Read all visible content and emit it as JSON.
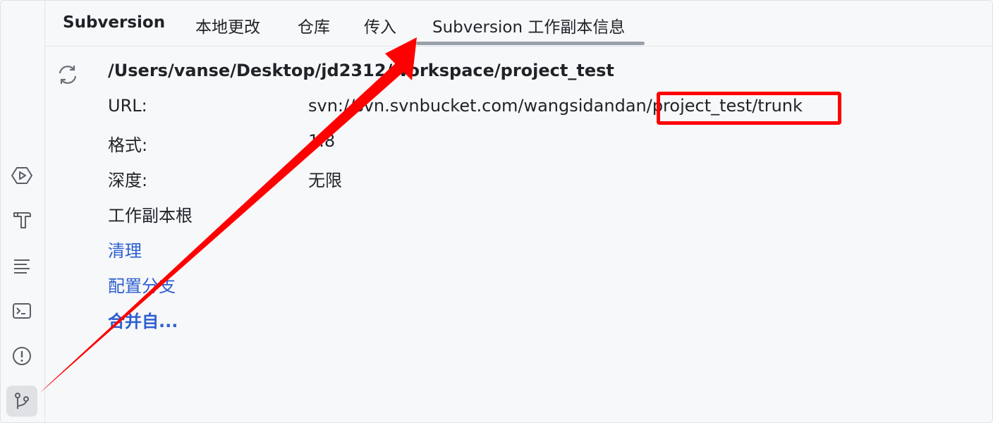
{
  "tabs": [
    {
      "label": "Subversion",
      "active": false
    },
    {
      "label": "本地更改",
      "active": false
    },
    {
      "label": "仓库",
      "active": false
    },
    {
      "label": "传入",
      "active": false
    },
    {
      "label": "Subversion 工作副本信息",
      "active": true
    }
  ],
  "info": {
    "path": "/Users/vanse/Desktop/jd2312/workspace/project_test",
    "url_label": "URL:",
    "url_value": "svn://svn.svnbucket.com/wangsidandan/project_test/trunk",
    "format_label": "格式:",
    "format_value": "1.8",
    "depth_label": "深度:",
    "depth_value": "无限",
    "wc_root_label": "工作副本根"
  },
  "actions": {
    "cleanup": "清理",
    "configure_branches": "配置分支",
    "merge_from": "合并自..."
  },
  "toolstrip": {
    "items": [
      "run-icon",
      "build-hammer-icon",
      "structure-icon",
      "terminal-icon",
      "problems-icon",
      "version-control-icon"
    ],
    "active": "version-control-icon"
  },
  "colors": {
    "annotation": "#ff0000",
    "link": "#2d5fd0",
    "background": "#f7f8fa"
  }
}
